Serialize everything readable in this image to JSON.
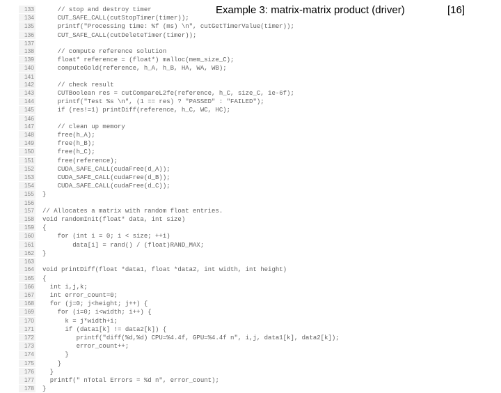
{
  "header": {
    "title": "Example 3: matrix-matrix product (driver)",
    "pagenum": "[16]"
  },
  "code": {
    "lines": [
      {
        "n": "133",
        "t": "    // stop and destroy timer"
      },
      {
        "n": "134",
        "t": "    CUT_SAFE_CALL(cutStopTimer(timer));"
      },
      {
        "n": "135",
        "t": "    printf(\"Processing time: %f (ms) \\n\", cutGetTimerValue(timer));"
      },
      {
        "n": "136",
        "t": "    CUT_SAFE_CALL(cutDeleteTimer(timer));"
      },
      {
        "n": "137",
        "t": ""
      },
      {
        "n": "138",
        "t": "    // compute reference solution"
      },
      {
        "n": "139",
        "t": "    float* reference = (float*) malloc(mem_size_C);"
      },
      {
        "n": "140",
        "t": "    computeGold(reference, h_A, h_B, HA, WA, WB);"
      },
      {
        "n": "141",
        "t": ""
      },
      {
        "n": "142",
        "t": "    // check result"
      },
      {
        "n": "143",
        "t": "    CUTBoolean res = cutCompareL2fe(reference, h_C, size_C, 1e-6f);"
      },
      {
        "n": "144",
        "t": "    printf(\"Test %s \\n\", (1 == res) ? \"PASSED\" : \"FAILED\");"
      },
      {
        "n": "145",
        "t": "    if (res!=1) printDiff(reference, h_C, WC, HC);"
      },
      {
        "n": "146",
        "t": ""
      },
      {
        "n": "147",
        "t": "    // clean up memory"
      },
      {
        "n": "148",
        "t": "    free(h_A);"
      },
      {
        "n": "149",
        "t": "    free(h_B);"
      },
      {
        "n": "150",
        "t": "    free(h_C);"
      },
      {
        "n": "151",
        "t": "    free(reference);"
      },
      {
        "n": "152",
        "t": "    CUDA_SAFE_CALL(cudaFree(d_A));"
      },
      {
        "n": "153",
        "t": "    CUDA_SAFE_CALL(cudaFree(d_B));"
      },
      {
        "n": "154",
        "t": "    CUDA_SAFE_CALL(cudaFree(d_C));"
      },
      {
        "n": "155",
        "t": "}"
      },
      {
        "n": "156",
        "t": ""
      },
      {
        "n": "157",
        "t": "// Allocates a matrix with random float entries."
      },
      {
        "n": "158",
        "t": "void randomInit(float* data, int size)"
      },
      {
        "n": "159",
        "t": "{"
      },
      {
        "n": "160",
        "t": "    for (int i = 0; i < size; ++i)"
      },
      {
        "n": "161",
        "t": "        data[i] = rand() / (float)RAND_MAX;"
      },
      {
        "n": "162",
        "t": "}"
      },
      {
        "n": "163",
        "t": ""
      },
      {
        "n": "164",
        "t": "void printDiff(float *data1, float *data2, int width, int height)"
      },
      {
        "n": "165",
        "t": "{"
      },
      {
        "n": "166",
        "t": "  int i,j,k;"
      },
      {
        "n": "167",
        "t": "  int error_count=0;"
      },
      {
        "n": "168",
        "t": "  for (j=0; j<height; j++) {"
      },
      {
        "n": "169",
        "t": "    for (i=0; i<width; i++) {"
      },
      {
        "n": "170",
        "t": "      k = j*width+i;"
      },
      {
        "n": "171",
        "t": "      if (data1[k] != data2[k]) {"
      },
      {
        "n": "172",
        "t": "         printf(\"diff(%d,%d) CPU=%4.4f, GPU=%4.4f n\", i,j, data1[k], data2[k]);"
      },
      {
        "n": "173",
        "t": "         error_count++;"
      },
      {
        "n": "174",
        "t": "      }"
      },
      {
        "n": "175",
        "t": "    }"
      },
      {
        "n": "176",
        "t": "  }"
      },
      {
        "n": "177",
        "t": "  printf(\" nTotal Errors = %d n\", error_count);"
      },
      {
        "n": "178",
        "t": "}"
      }
    ]
  }
}
